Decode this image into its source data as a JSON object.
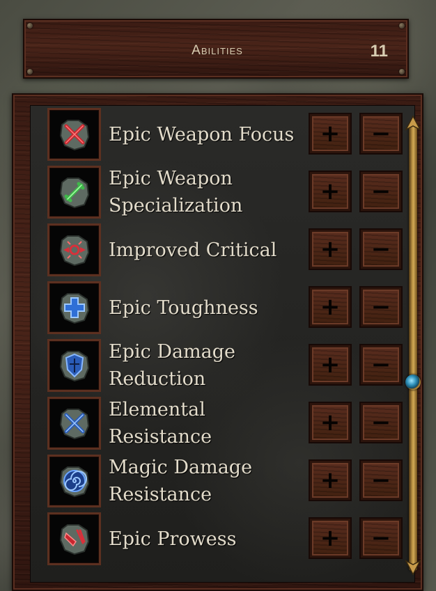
{
  "header": {
    "title": "Abilities",
    "points": "11"
  },
  "abilities": [
    {
      "label": "Epic Weapon Focus",
      "icon": "crossed-swords-red-icon",
      "plus": "+",
      "minus": "−"
    },
    {
      "label": "Epic Weapon\nSpecialization",
      "icon": "sword-green-icon",
      "plus": "+",
      "minus": "−"
    },
    {
      "label": "Improved Critical",
      "icon": "critical-burst-red-icon",
      "plus": "+",
      "minus": "−"
    },
    {
      "label": "Epic Toughness",
      "icon": "cross-blue-icon",
      "plus": "+",
      "minus": "−"
    },
    {
      "label": "Epic Damage\nReduction",
      "icon": "shield-blue-icon",
      "plus": "+",
      "minus": "−"
    },
    {
      "label": "Elemental\nResistance",
      "icon": "crossed-blades-blue-icon",
      "plus": "+",
      "minus": "−"
    },
    {
      "label": "Magic Damage\nResistance",
      "icon": "spiral-blue-icon",
      "plus": "+",
      "minus": "−"
    },
    {
      "label": "Epic Prowess",
      "icon": "prowess-red-icon",
      "plus": "+",
      "minus": "−"
    }
  ],
  "colors": {
    "wood": "#4a2419",
    "text": "#e3dccb",
    "scrollbar": "#c79b4a"
  }
}
